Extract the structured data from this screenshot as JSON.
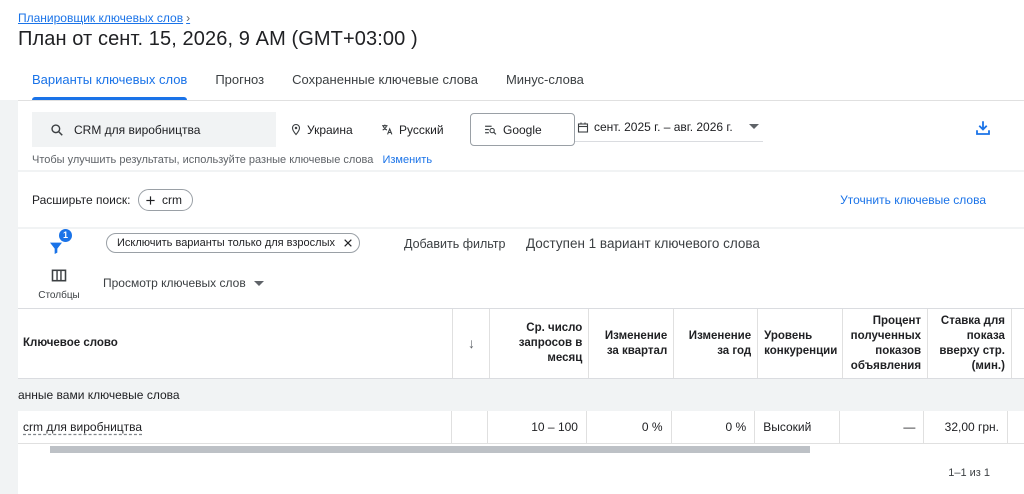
{
  "header": {
    "breadcrumb": "Планировщик ключевых слов",
    "title": "План от сент. 15, 2026, 9 AM (GMT+03:00 )",
    "tabs": [
      {
        "label": "Варианты ключевых слов",
        "active": true
      },
      {
        "label": "Прогноз",
        "active": false
      },
      {
        "label": "Сохраненные ключевые слова",
        "active": false
      },
      {
        "label": "Минус-слова",
        "active": false
      }
    ]
  },
  "controls": {
    "search_value": "CRM для виробництва",
    "location": "Украина",
    "language": "Русский",
    "network": "Google",
    "date_range": "сент. 2025 г. – авг. 2026 г.",
    "hint_text": "Чтобы улучшить результаты, используйте разные ключевые слова",
    "hint_link": "Изменить"
  },
  "expand": {
    "label": "Расширьте поиск:",
    "chip": "crm",
    "refine_link": "Уточнить ключевые слова"
  },
  "toolbar": {
    "filter_badge": "1",
    "adult_chip": "Исключить варианты только для взрослых",
    "add_filter": "Добавить фильтр",
    "available": "Доступен 1 вариант ключевого слова",
    "columns_label": "Столбцы",
    "view_label": "Просмотр ключевых слов"
  },
  "table": {
    "headers": [
      "Ключевое слово",
      "↓",
      "Ср. число запросов в месяц",
      "Изменение за квартал",
      "Изменение за год",
      "Уровень конкуренции",
      "Процент полученных показов объявления",
      "Ставка для показа вверху стр. (мин.)"
    ],
    "group_label": "анные вами ключевые слова",
    "rows": [
      {
        "keyword": "crm для виробництва",
        "avg_searches": "10 – 100",
        "quarter_change": "0 %",
        "year_change": "0 %",
        "competition": "Высокий",
        "impression_share": "—",
        "top_bid_low": "32,00 грн."
      }
    ],
    "pagination": "1–1 из 1"
  },
  "colors": {
    "accent": "#1a73e8",
    "background": "#f1f3f4",
    "text": "#202124"
  }
}
